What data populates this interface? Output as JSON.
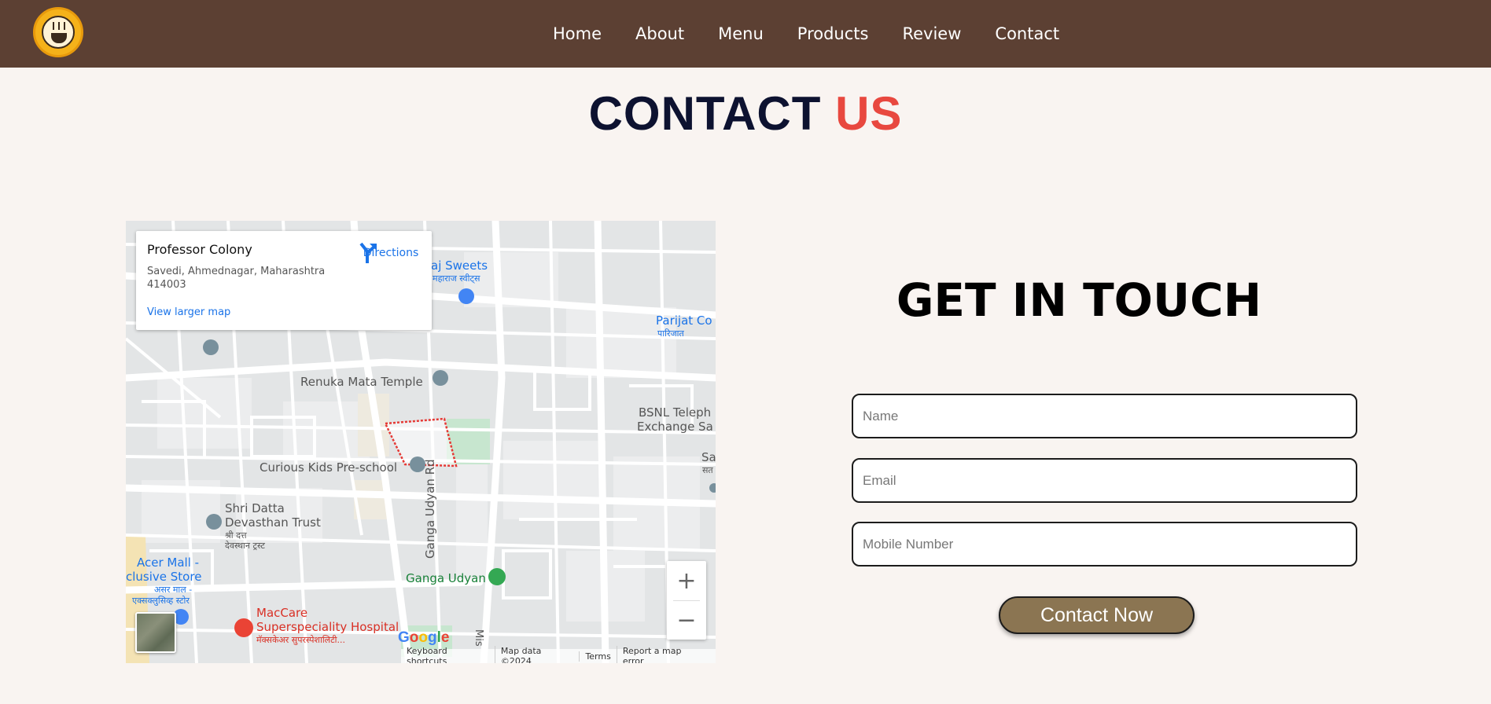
{
  "header": {
    "logo_icon": "coffee-cup-logo",
    "nav": [
      "Home",
      "About",
      "Menu",
      "Products",
      "Review",
      "Contact"
    ]
  },
  "section": {
    "title_part1": "CONTACT",
    "title_part2": "US",
    "colors": {
      "dark": "#0d1230",
      "accent": "#e8483f",
      "header_bg": "#5c4033",
      "page_bg": "#f9f4f1",
      "button_bg": "#8b7552"
    }
  },
  "map": {
    "card": {
      "title": "Professor Colony",
      "address": "Savedi, Ahmednagar, Maharashtra 414003",
      "directions": "Directions",
      "larger_map": "View larger map"
    },
    "places": {
      "sweets": "aj Sweets",
      "sweets_local": "महाराज स्वीट्स",
      "parijat": "Parijat Co",
      "parijat_local": "पारिजात",
      "temple": "Renuka Mata Temple",
      "bsnl_1": "BSNL Teleph",
      "bsnl_2": "Exchange Sa",
      "sa": "Sa",
      "sa_local": "सत",
      "school": "Curious Kids Pre-school",
      "road": "Ganga Udyan Rd",
      "trust_1": "Shri Datta",
      "trust_2": "Devasthan Trust",
      "trust_local_1": "श्री दत्त",
      "trust_local_2": "देवस्थान ट्रस्ट",
      "mall_1": "Acer Mall -",
      "mall_2": "clusive Store",
      "mall_local_1": "असर माल -",
      "mall_local_2": "एक्सक्लुसिव्ह स्टोर",
      "park": "Ganga Udyan",
      "hospital_1": "MacCare",
      "hospital_2": "Superspeciality Hospital",
      "hospital_local": "मॅक्सकेअर सुपरस्पेशालिटी...",
      "mis": "Mis"
    },
    "zoom_in": "+",
    "zoom_out": "−",
    "google": "Google",
    "footer": [
      "Keyboard shortcuts",
      "Map data ©2024",
      "Terms",
      "Report a map error"
    ]
  },
  "form": {
    "title": "GET IN TOUCH",
    "name_placeholder": "Name",
    "email_placeholder": "Email",
    "mobile_placeholder": "Mobile Number",
    "submit": "Contact Now"
  }
}
